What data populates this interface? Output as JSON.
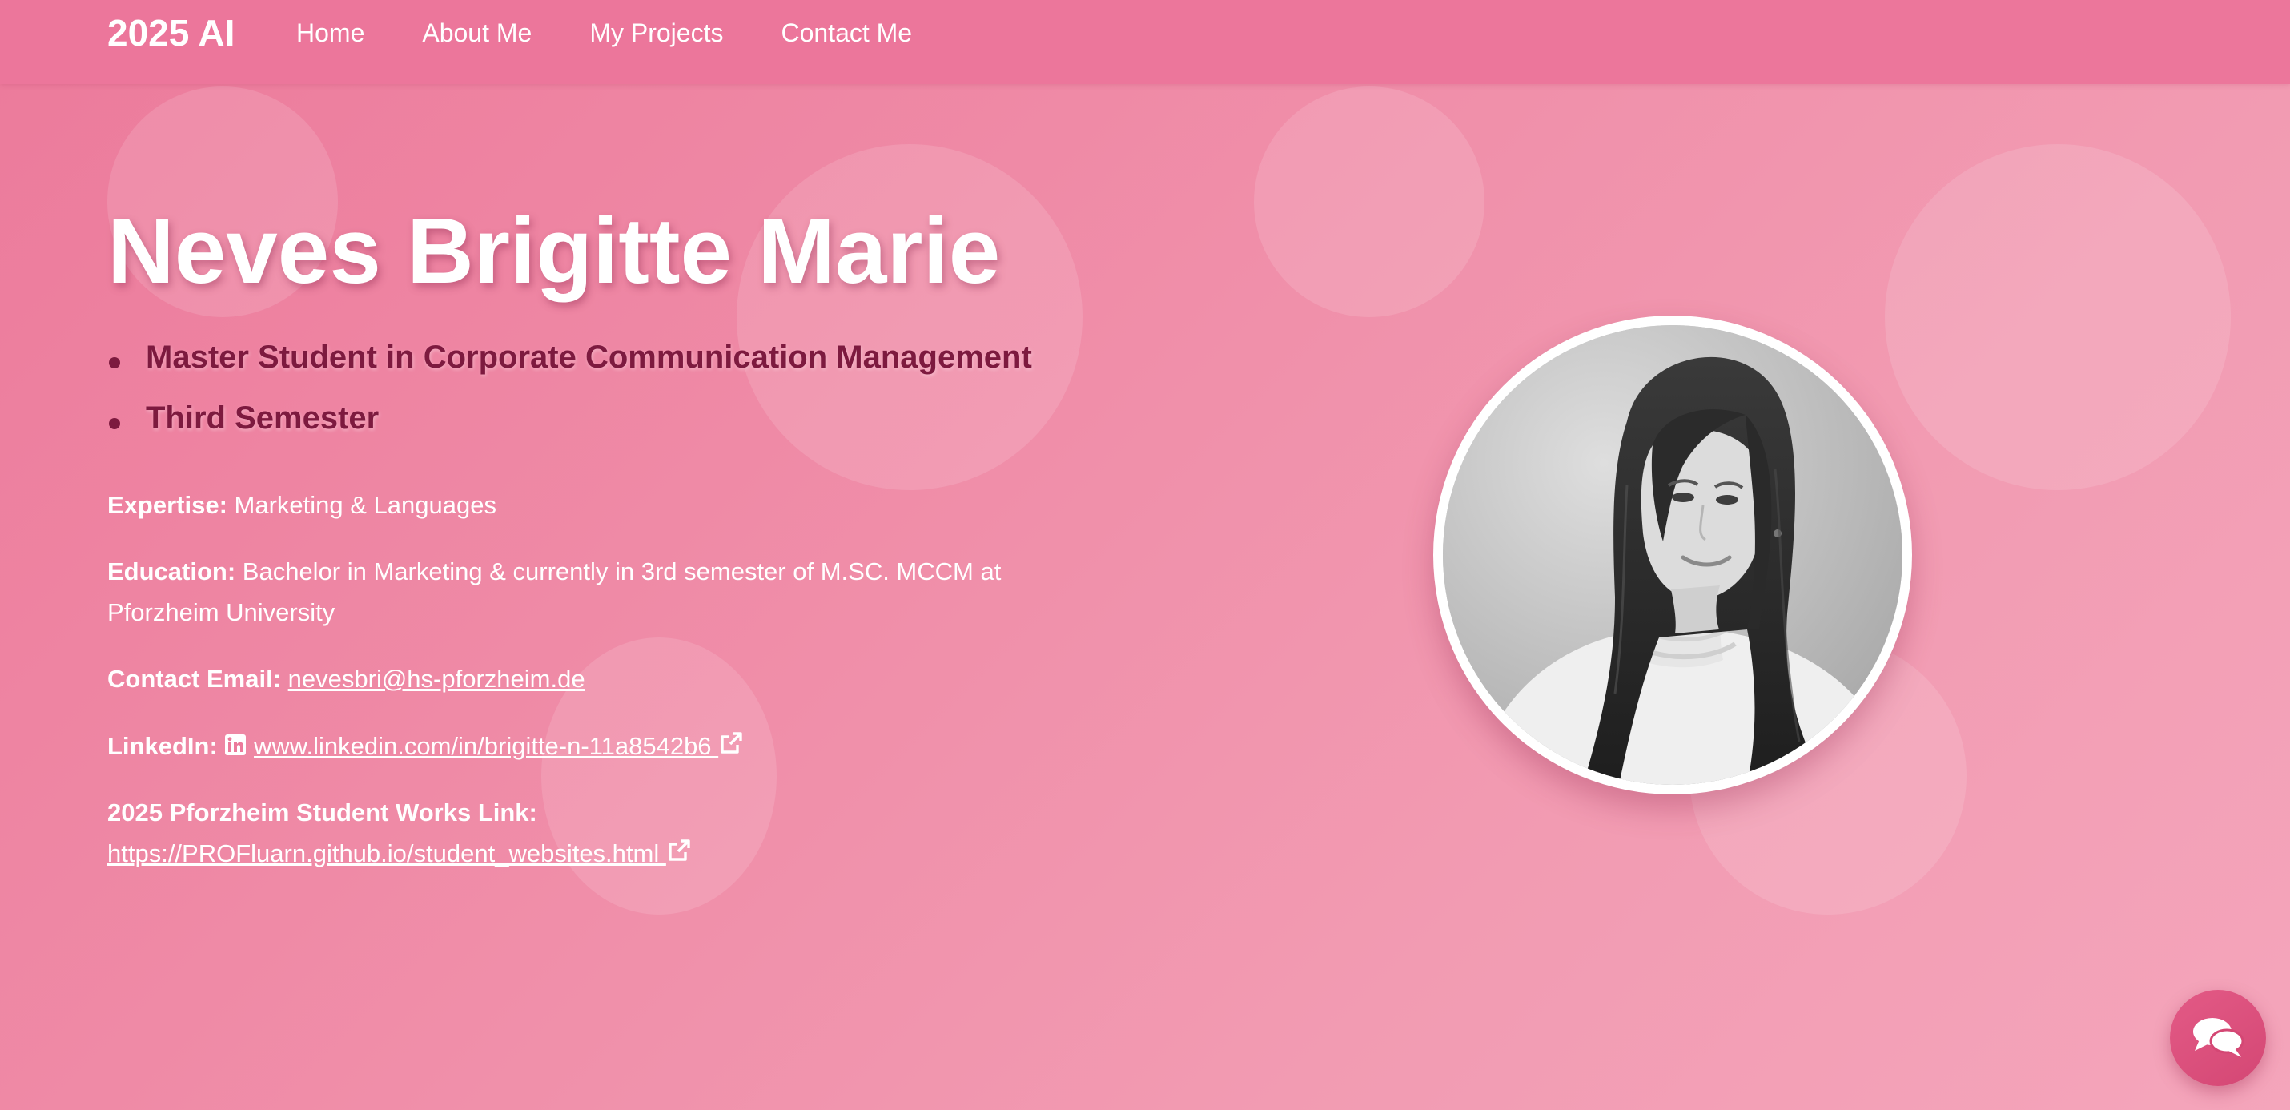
{
  "nav": {
    "brand": "2025 AI",
    "links": [
      {
        "label": "Home"
      },
      {
        "label": "About Me"
      },
      {
        "label": "My Projects"
      },
      {
        "label": "Contact Me"
      }
    ]
  },
  "hero": {
    "name": "Neves Brigitte Marie",
    "roles": [
      "Master Student in Corporate Communication Management",
      "Third Semester"
    ]
  },
  "details": {
    "expertise": {
      "label": "Expertise:",
      "value": " Marketing & Languages"
    },
    "education": {
      "label": "Education:",
      "value": " Bachelor in Marketing & currently in 3rd semester of M.SC. MCCM at Pforzheim University"
    },
    "email": {
      "label": "Contact Email:",
      "value": "nevesbri@hs-pforzheim.de"
    },
    "linkedin": {
      "label": "LinkedIn:",
      "value": " www.linkedin.com/in/brigitte-n-11a8542b6 "
    },
    "works": {
      "label": "2025 Pforzheim Student Works Link:",
      "value": "https://PROFluarn.github.io/student_websites.html "
    }
  },
  "icons": {
    "linkedin": "linkedin-icon",
    "external_link": "external-link-icon",
    "chat": "chat-bubbles-icon"
  },
  "colors": {
    "nav_background": "#ec769b",
    "page_gradient_start": "#ec7a9b",
    "page_gradient_end": "#f4a5bb",
    "role_text": "#7d1a3f",
    "chat_button": "#d44774"
  }
}
